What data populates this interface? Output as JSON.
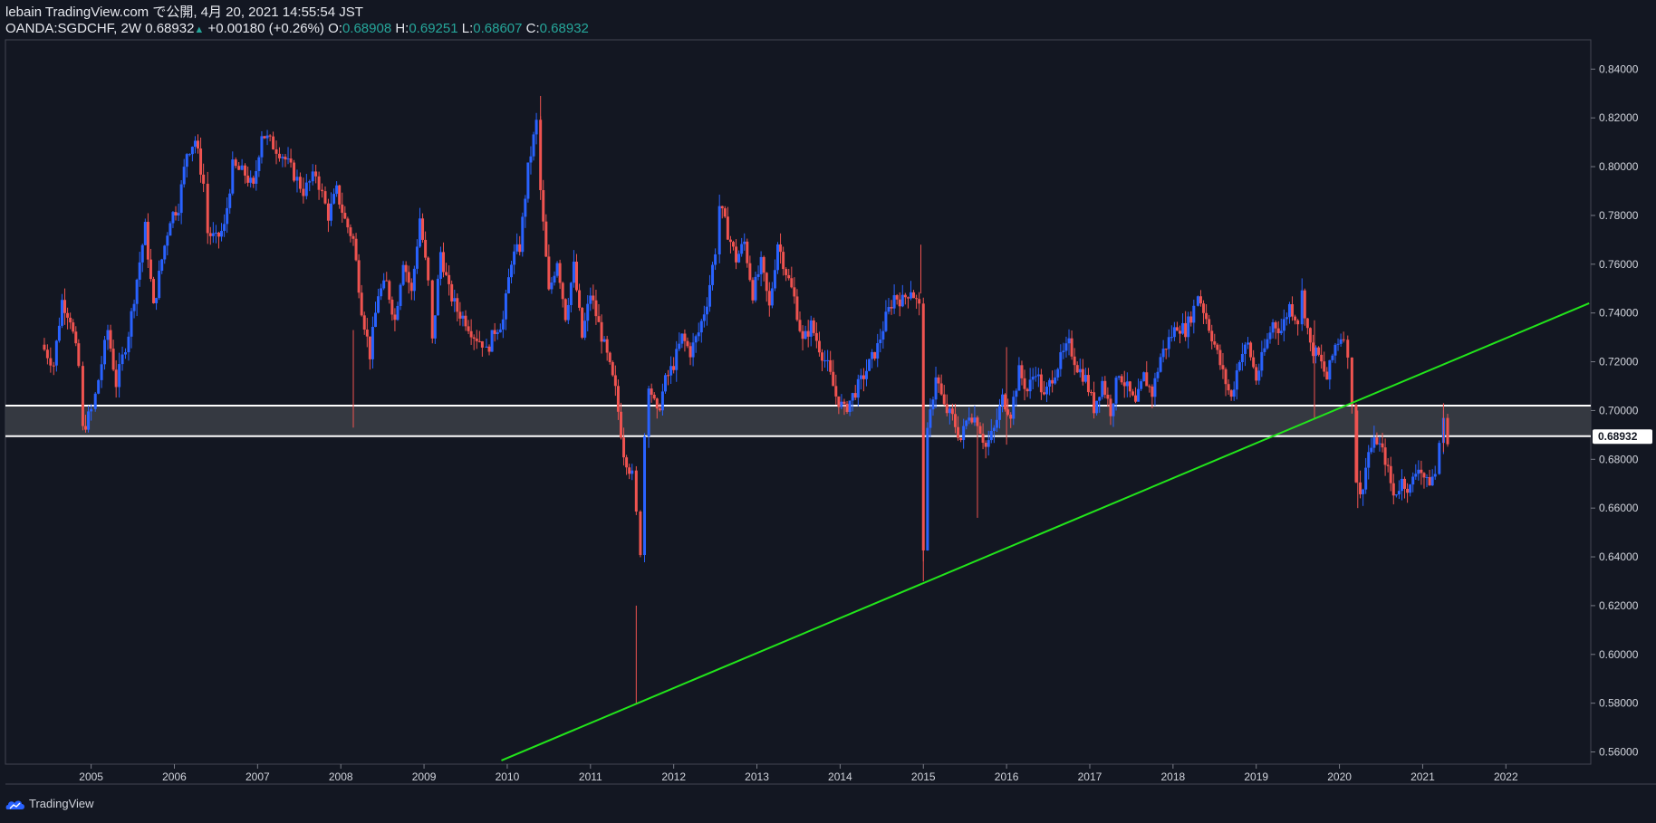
{
  "header": {
    "published": "lebain TradingView.com で公開, 4月 20, 2021 14:55:54 JST",
    "symbol": "OANDA:SGDCHF, 2W",
    "last": "0.68932",
    "arrow": "▲",
    "change": "+0.00180 (+0.26%)",
    "o_label": "O:",
    "o_value": "0.68908",
    "h_label": "H:",
    "h_value": "0.69251",
    "l_label": "L:",
    "l_value": "0.68607",
    "c_label": "C:",
    "c_value": "0.68932"
  },
  "footer": {
    "brand": "TradingView"
  },
  "colors": {
    "background": "#131722",
    "up": "#2962ff",
    "down": "#ef5350",
    "trendline": "#22e51b",
    "zone_fill": "#3a3d45",
    "zone_border": "#ffffff",
    "price_label_bg": "#ffffff"
  },
  "chart_data": {
    "type": "candlestick",
    "interval": "2W",
    "x_ticks": [
      "2005",
      "2006",
      "2007",
      "2008",
      "2009",
      "2010",
      "2011",
      "2012",
      "2013",
      "2014",
      "2015",
      "2016",
      "2017",
      "2018",
      "2019",
      "2020",
      "2021",
      "2022"
    ],
    "y_ticks": [
      "0.84000",
      "0.82000",
      "0.80000",
      "0.78000",
      "0.76000",
      "0.74000",
      "0.72000",
      "0.70000",
      "0.68000",
      "0.66000",
      "0.64000",
      "0.62000",
      "0.60000",
      "0.58000",
      "0.56000"
    ],
    "ylim": [
      0.555,
      0.852
    ],
    "xlim": [
      2003.97,
      2023.02
    ],
    "last_price_label": "0.68932",
    "last_price": 0.68932,
    "zone": {
      "top": 0.702,
      "bottom": 0.6895
    },
    "trendline": {
      "x1": 2009.93,
      "y1": 0.5565,
      "x2": 2023.0,
      "y2": 0.744
    },
    "close_path": [
      [
        2004.4,
        0.727
      ],
      [
        2004.55,
        0.719
      ],
      [
        2004.65,
        0.745
      ],
      [
        2004.75,
        0.738
      ],
      [
        2004.85,
        0.718
      ],
      [
        2004.9,
        0.692
      ],
      [
        2005.0,
        0.7
      ],
      [
        2005.05,
        0.706
      ],
      [
        2005.2,
        0.733
      ],
      [
        2005.3,
        0.711
      ],
      [
        2005.45,
        0.732
      ],
      [
        2005.55,
        0.754
      ],
      [
        2005.65,
        0.775
      ],
      [
        2005.75,
        0.742
      ],
      [
        2005.85,
        0.762
      ],
      [
        2005.95,
        0.779
      ],
      [
        2006.05,
        0.784
      ],
      [
        2006.15,
        0.806
      ],
      [
        2006.25,
        0.811
      ],
      [
        2006.35,
        0.793
      ],
      [
        2006.4,
        0.773
      ],
      [
        2006.5,
        0.77
      ],
      [
        2006.6,
        0.775
      ],
      [
        2006.7,
        0.8
      ],
      [
        2006.85,
        0.797
      ],
      [
        2006.95,
        0.791
      ],
      [
        2007.05,
        0.814
      ],
      [
        2007.15,
        0.81
      ],
      [
        2007.3,
        0.805
      ],
      [
        2007.4,
        0.799
      ],
      [
        2007.55,
        0.79
      ],
      [
        2007.7,
        0.797
      ],
      [
        2007.85,
        0.78
      ],
      [
        2007.95,
        0.79
      ],
      [
        2008.05,
        0.778
      ],
      [
        2008.15,
        0.77
      ],
      [
        2008.25,
        0.742
      ],
      [
        2008.35,
        0.723
      ],
      [
        2008.45,
        0.748
      ],
      [
        2008.55,
        0.752
      ],
      [
        2008.65,
        0.737
      ],
      [
        2008.75,
        0.762
      ],
      [
        2008.85,
        0.748
      ],
      [
        2008.95,
        0.779
      ],
      [
        2009.05,
        0.752
      ],
      [
        2009.1,
        0.728
      ],
      [
        2009.2,
        0.765
      ],
      [
        2009.3,
        0.749
      ],
      [
        2009.4,
        0.741
      ],
      [
        2009.5,
        0.737
      ],
      [
        2009.6,
        0.731
      ],
      [
        2009.7,
        0.728
      ],
      [
        2009.75,
        0.724
      ],
      [
        2009.85,
        0.733
      ],
      [
        2009.95,
        0.737
      ],
      [
        2010.05,
        0.762
      ],
      [
        2010.15,
        0.767
      ],
      [
        2010.25,
        0.799
      ],
      [
        2010.35,
        0.818
      ],
      [
        2010.4,
        0.79
      ],
      [
        2010.5,
        0.748
      ],
      [
        2010.6,
        0.762
      ],
      [
        2010.7,
        0.739
      ],
      [
        2010.8,
        0.759
      ],
      [
        2010.9,
        0.73
      ],
      [
        2011.0,
        0.748
      ],
      [
        2011.1,
        0.735
      ],
      [
        2011.2,
        0.722
      ],
      [
        2011.3,
        0.708
      ],
      [
        2011.4,
        0.683
      ],
      [
        2011.5,
        0.673
      ],
      [
        2011.55,
        0.657
      ],
      [
        2011.6,
        0.643
      ],
      [
        2011.65,
        0.69
      ],
      [
        2011.7,
        0.712
      ],
      [
        2011.8,
        0.698
      ],
      [
        2011.9,
        0.712
      ],
      [
        2012.0,
        0.719
      ],
      [
        2012.1,
        0.73
      ],
      [
        2012.2,
        0.724
      ],
      [
        2012.3,
        0.732
      ],
      [
        2012.4,
        0.745
      ],
      [
        2012.5,
        0.766
      ],
      [
        2012.55,
        0.784
      ],
      [
        2012.65,
        0.773
      ],
      [
        2012.75,
        0.762
      ],
      [
        2012.85,
        0.769
      ],
      [
        2012.95,
        0.748
      ],
      [
        2013.05,
        0.76
      ],
      [
        2013.15,
        0.742
      ],
      [
        2013.25,
        0.769
      ],
      [
        2013.35,
        0.757
      ],
      [
        2013.45,
        0.746
      ],
      [
        2013.55,
        0.728
      ],
      [
        2013.65,
        0.735
      ],
      [
        2013.75,
        0.726
      ],
      [
        2013.85,
        0.718
      ],
      [
        2013.95,
        0.706
      ],
      [
        2014.05,
        0.7
      ],
      [
        2014.15,
        0.706
      ],
      [
        2014.25,
        0.712
      ],
      [
        2014.35,
        0.719
      ],
      [
        2014.45,
        0.726
      ],
      [
        2014.55,
        0.738
      ],
      [
        2014.65,
        0.747
      ],
      [
        2014.75,
        0.745
      ],
      [
        2014.85,
        0.75
      ],
      [
        2014.95,
        0.742
      ],
      [
        2015.0,
        0.645
      ],
      [
        2015.05,
        0.69
      ],
      [
        2015.15,
        0.715
      ],
      [
        2015.25,
        0.701
      ],
      [
        2015.35,
        0.697
      ],
      [
        2015.45,
        0.688
      ],
      [
        2015.55,
        0.699
      ],
      [
        2015.65,
        0.696
      ],
      [
        2015.75,
        0.685
      ],
      [
        2015.85,
        0.692
      ],
      [
        2015.95,
        0.705
      ],
      [
        2016.05,
        0.699
      ],
      [
        2016.15,
        0.716
      ],
      [
        2016.25,
        0.708
      ],
      [
        2016.35,
        0.717
      ],
      [
        2016.45,
        0.705
      ],
      [
        2016.55,
        0.714
      ],
      [
        2016.65,
        0.721
      ],
      [
        2016.75,
        0.727
      ],
      [
        2016.85,
        0.718
      ],
      [
        2016.95,
        0.713
      ],
      [
        2017.05,
        0.701
      ],
      [
        2017.15,
        0.712
      ],
      [
        2017.25,
        0.7
      ],
      [
        2017.35,
        0.716
      ],
      [
        2017.45,
        0.709
      ],
      [
        2017.55,
        0.702
      ],
      [
        2017.65,
        0.714
      ],
      [
        2017.75,
        0.707
      ],
      [
        2017.85,
        0.722
      ],
      [
        2017.95,
        0.729
      ],
      [
        2018.05,
        0.735
      ],
      [
        2018.15,
        0.733
      ],
      [
        2018.25,
        0.742
      ],
      [
        2018.3,
        0.748
      ],
      [
        2018.4,
        0.738
      ],
      [
        2018.5,
        0.727
      ],
      [
        2018.6,
        0.715
      ],
      [
        2018.7,
        0.705
      ],
      [
        2018.8,
        0.722
      ],
      [
        2018.9,
        0.727
      ],
      [
        2019.0,
        0.713
      ],
      [
        2019.1,
        0.725
      ],
      [
        2019.2,
        0.736
      ],
      [
        2019.3,
        0.733
      ],
      [
        2019.4,
        0.743
      ],
      [
        2019.5,
        0.737
      ],
      [
        2019.55,
        0.748
      ],
      [
        2019.65,
        0.726
      ],
      [
        2019.75,
        0.722
      ],
      [
        2019.85,
        0.713
      ],
      [
        2019.95,
        0.727
      ],
      [
        2020.05,
        0.732
      ],
      [
        2020.1,
        0.72
      ],
      [
        2020.15,
        0.705
      ],
      [
        2020.2,
        0.672
      ],
      [
        2020.25,
        0.664
      ],
      [
        2020.35,
        0.683
      ],
      [
        2020.45,
        0.688
      ],
      [
        2020.55,
        0.68
      ],
      [
        2020.65,
        0.665
      ],
      [
        2020.75,
        0.671
      ],
      [
        2020.85,
        0.668
      ],
      [
        2020.95,
        0.678
      ],
      [
        2021.05,
        0.67
      ],
      [
        2021.15,
        0.674
      ],
      [
        2021.2,
        0.687
      ],
      [
        2021.25,
        0.695
      ],
      [
        2021.3,
        0.689
      ]
    ],
    "spikes": [
      [
        2011.55,
        0.58
      ],
      [
        2015.0,
        0.63
      ],
      [
        2014.97,
        0.768
      ],
      [
        2010.4,
        0.829
      ],
      [
        2008.15,
        0.693
      ],
      [
        2015.65,
        0.656
      ],
      [
        2016.0,
        0.686
      ],
      [
        2019.7,
        0.697
      ],
      [
        2020.22,
        0.66
      ],
      [
        2021.25,
        0.703
      ]
    ]
  }
}
